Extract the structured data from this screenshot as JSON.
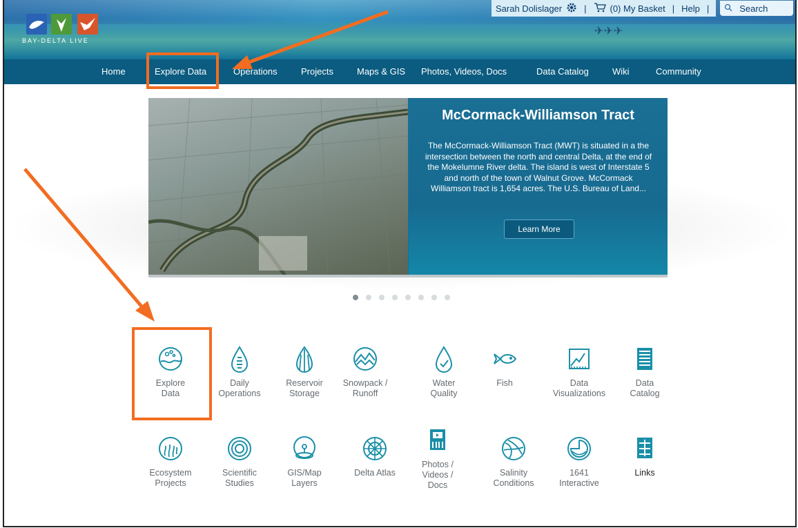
{
  "header": {
    "logo_text": "BAY-DELTA LIVE",
    "user_name": "Sarah Dolislager",
    "basket_label": "(0) My Basket",
    "help_label": "Help",
    "search_label": "Search"
  },
  "nav": {
    "items": [
      {
        "label": "Home"
      },
      {
        "label": "Explore Data"
      },
      {
        "label": "Operations"
      },
      {
        "label": "Projects"
      },
      {
        "label": "Maps & GIS"
      },
      {
        "label": "Photos, Videos, Docs"
      },
      {
        "label": "Data Catalog"
      },
      {
        "label": "Wiki"
      },
      {
        "label": "Community"
      }
    ]
  },
  "hero": {
    "title": "McCormack-Williamson Tract",
    "description": "The McCormack-Williamson Tract (MWT) is situated in a the intersection between the north and central Delta, at the end of the Mokelumne River delta. The island is west of Interstate 5 and north of the town of Walnut Grove. McCormack Williamson tract is 1,654 acres. The U.S. Bureau of Land...",
    "button_label": "Learn More",
    "slide_count": 8,
    "active_slide": 1
  },
  "grid": {
    "row1": [
      {
        "line1": "Explore",
        "line2": "Data",
        "icon": "globe-icon"
      },
      {
        "line1": "Daily",
        "line2": "Operations",
        "icon": "drop-gauge-icon"
      },
      {
        "line1": "Reservoir",
        "line2": "Storage",
        "icon": "dam-icon"
      },
      {
        "line1": "Snowpack /",
        "line2": "Runoff",
        "icon": "mountain-icon"
      },
      {
        "line1": "Water",
        "line2": "Quality",
        "icon": "drop-check-icon"
      },
      {
        "line1": "Fish",
        "line2": "",
        "icon": "fish-icon"
      },
      {
        "line1": "Data",
        "line2": "Visualizations",
        "icon": "chart-icon"
      },
      {
        "line1": "Data",
        "line2": "Catalog",
        "icon": "catalog-icon"
      }
    ],
    "row2": [
      {
        "line1": "Ecosystem",
        "line2": "Projects",
        "line3": "",
        "icon": "ecosystem-icon"
      },
      {
        "line1": "Scientific",
        "line2": "Studies",
        "line3": "",
        "icon": "target-icon"
      },
      {
        "line1": "GIS/Map",
        "line2": "Layers",
        "line3": "",
        "icon": "map-pin-icon"
      },
      {
        "line1": "Delta Atlas",
        "line2": "",
        "line3": "",
        "icon": "compass-icon"
      },
      {
        "line1": "Photos /",
        "line2": "Videos /",
        "line3": "Docs",
        "icon": "film-icon"
      },
      {
        "line1": "Salinity",
        "line2": "Conditions",
        "line3": "",
        "icon": "salinity-icon"
      },
      {
        "line1": "1641",
        "line2": "Interactive",
        "line3": "",
        "icon": "clock-icon"
      },
      {
        "line1": "Links",
        "line2": "",
        "line3": "",
        "icon": "links-icon"
      }
    ]
  },
  "colors": {
    "accent_orange": "#f26d21",
    "nav_blue": "#0b5c80",
    "icon_teal": "#1a8fa8"
  }
}
